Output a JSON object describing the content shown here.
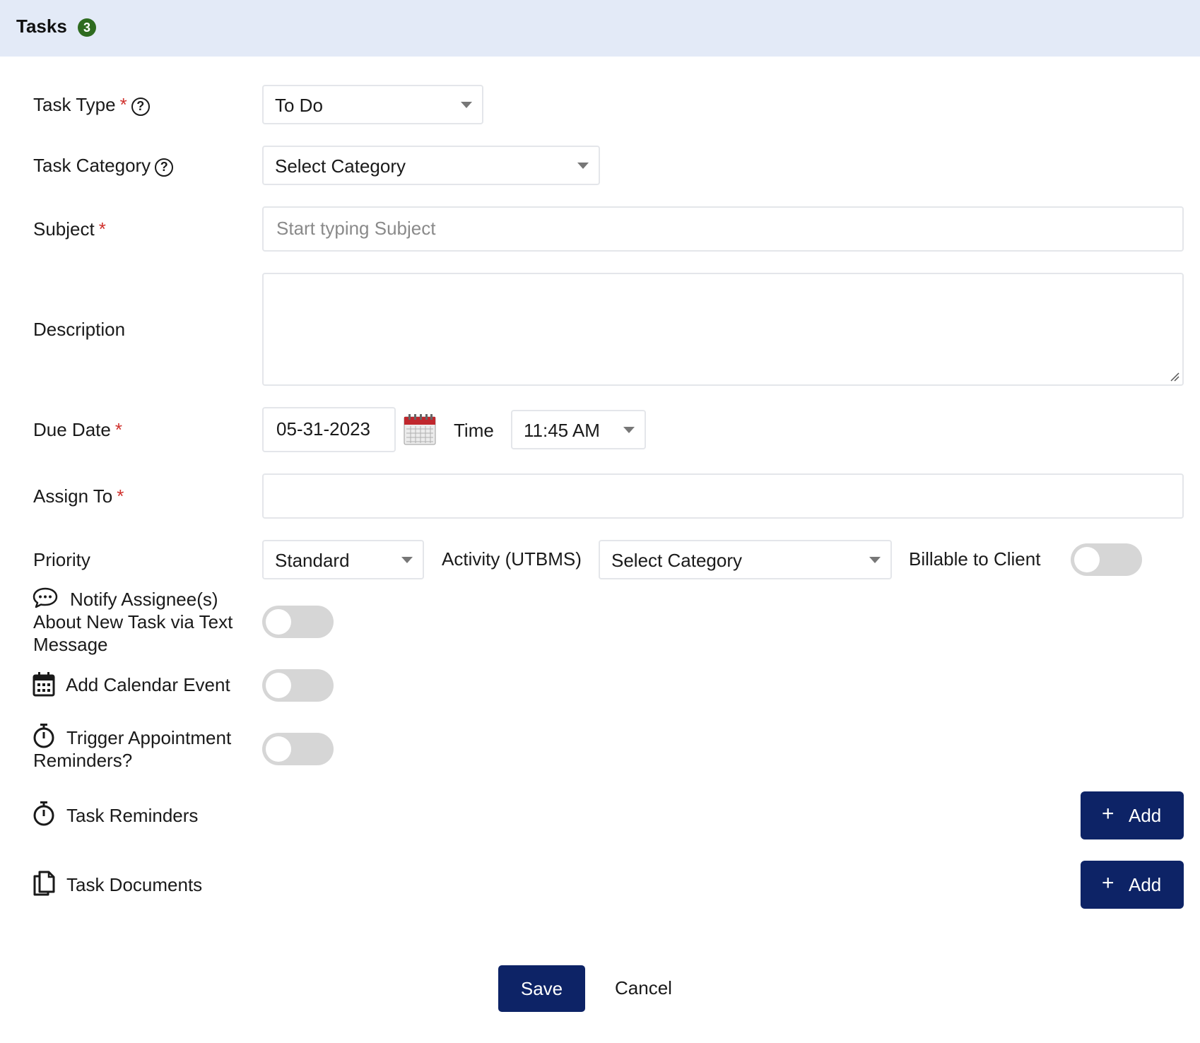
{
  "header": {
    "title": "Tasks",
    "step": "3"
  },
  "form": {
    "task_type": {
      "label": "Task Type",
      "required": "*",
      "help": "?",
      "value": "To Do"
    },
    "task_category": {
      "label": "Task Category",
      "help": "?",
      "value": "Select Category"
    },
    "subject": {
      "label": "Subject",
      "required": "*",
      "placeholder": "Start typing Subject",
      "value": ""
    },
    "description": {
      "label": "Description",
      "value": ""
    },
    "due_date": {
      "label": "Due Date",
      "required": "*",
      "value": "05-31-2023"
    },
    "time": {
      "label": "Time",
      "value": "11:45 AM"
    },
    "assign_to": {
      "label": "Assign To",
      "required": "*",
      "value": ""
    },
    "priority": {
      "label": "Priority",
      "value": "Standard"
    },
    "activity": {
      "label": "Activity (UTBMS)",
      "value": "Select Category"
    },
    "billable": {
      "label": "Billable to Client",
      "on": false
    },
    "notify": {
      "label_line1": "Notify Assignee(s)",
      "label_line2": "About New Task via Text",
      "label_line3": "Message",
      "on": false
    },
    "calendar_event": {
      "label": "Add Calendar Event",
      "on": false
    },
    "trigger_reminders": {
      "label_line1": "Trigger Appointment",
      "label_line2": "Reminders?",
      "on": false
    },
    "task_reminders": {
      "label": "Task Reminders",
      "add_label": "Add"
    },
    "task_documents": {
      "label": "Task Documents",
      "add_label": "Add"
    }
  },
  "actions": {
    "save_label": "Save",
    "cancel_label": "Cancel"
  },
  "colors": {
    "header_bg": "#e3eaf7",
    "primary": "#0d2366",
    "required": "#d0312d",
    "badge": "#2e6b1f",
    "toggle_off": "#d6d6d6"
  }
}
